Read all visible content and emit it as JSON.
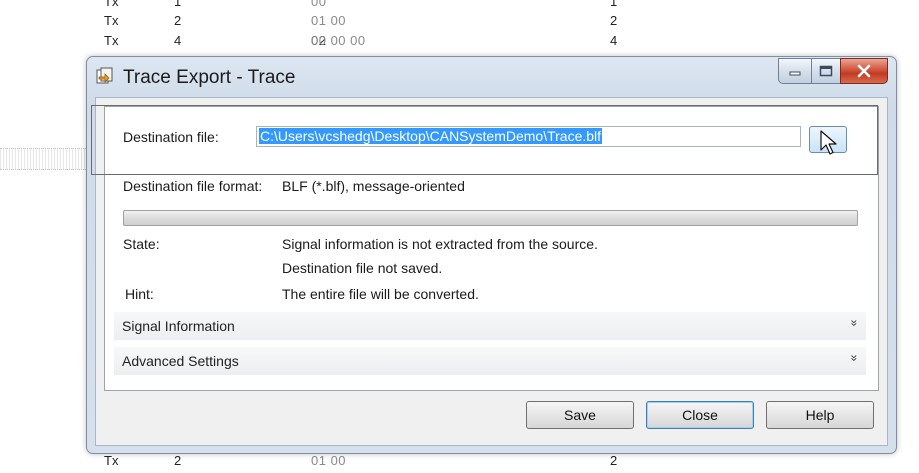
{
  "background_rows": [
    {
      "dir": "Tx",
      "len": "1",
      "bytes": "00",
      "bytes_dark": "",
      "count": "1"
    },
    {
      "dir": "Tx",
      "len": "2",
      "bytes": "01 00",
      "bytes_dark": "",
      "count": "2"
    },
    {
      "dir": "Tx",
      "len": "4",
      "bytes": "00 00 00",
      "bytes_dark": "02",
      "count": "4"
    },
    {
      "dir": "Tx",
      "len": "2",
      "bytes": "01 00",
      "bytes_dark": "",
      "count": "2"
    }
  ],
  "window": {
    "title": "Trace Export - Trace",
    "controls": {
      "minimize": "minimize",
      "maximize": "maximize",
      "close": "close"
    }
  },
  "form": {
    "destination_label": "Destination file:",
    "destination_value": "C:\\Users\\vcshedg\\Desktop\\CANSystemDemo\\Trace.blf",
    "format_label": "Destination file format:",
    "format_value": "BLF (*.blf), message-oriented",
    "progress": 0,
    "state_label": "State:",
    "state_line1": "Signal information is not extracted from the source.",
    "state_line2": "Destination file not saved.",
    "hint_label": "Hint:",
    "hint_value": "The entire file will be converted."
  },
  "sections": [
    {
      "title": "Signal Information",
      "chevron": "»"
    },
    {
      "title": "Advanced Settings",
      "chevron": "»"
    }
  ],
  "buttons": {
    "save": "Save",
    "close": "Close",
    "help": "Help"
  },
  "icons": {
    "app": "export-icon",
    "browse": "folder-browse-icon",
    "cursor": "mouse-cursor-icon"
  },
  "colors": {
    "selection": "#3399ff",
    "close_button": "#c13b22",
    "title_bar": "#d5e0ec"
  }
}
